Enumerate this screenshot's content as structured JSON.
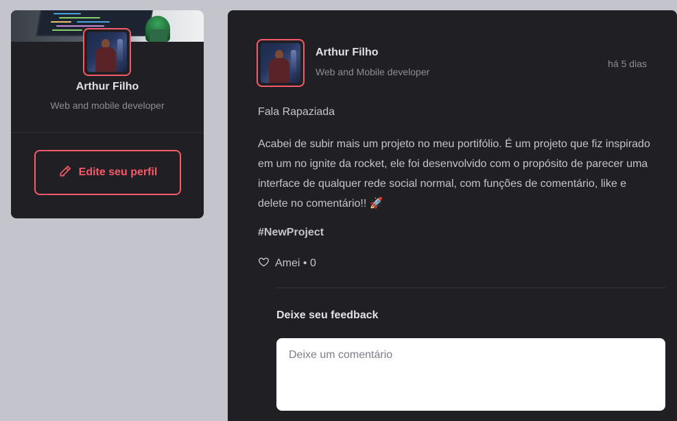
{
  "sidebar": {
    "name": "Arthur Filho",
    "role": "Web and mobile developer",
    "edit_button": "Edite seu perfil"
  },
  "post": {
    "author": {
      "name": "Arthur Filho",
      "role": "Web and Mobile developer"
    },
    "time": "há 5 dias",
    "greeting": "Fala Rapaziada",
    "body": "Acabei de subir mais um projeto no meu portifólio. É um projeto que fiz inspirado em um no ignite da rocket, ele foi desenvolvido com o propósito de parecer uma interface de qualquer rede social normal, com funções de comentário, like e delete no comentário!! 🚀",
    "hashtag": "#NewProject",
    "like_label": "Amei • 0",
    "feedback_title": "Deixe seu feedback",
    "comment_placeholder": "Deixe um comentário"
  },
  "icons": {
    "edit": "pencil-icon",
    "like": "heart-icon"
  },
  "colors": {
    "accent": "#f75a68",
    "card_bg": "#202024",
    "page_bg": "#c4c4cc"
  }
}
